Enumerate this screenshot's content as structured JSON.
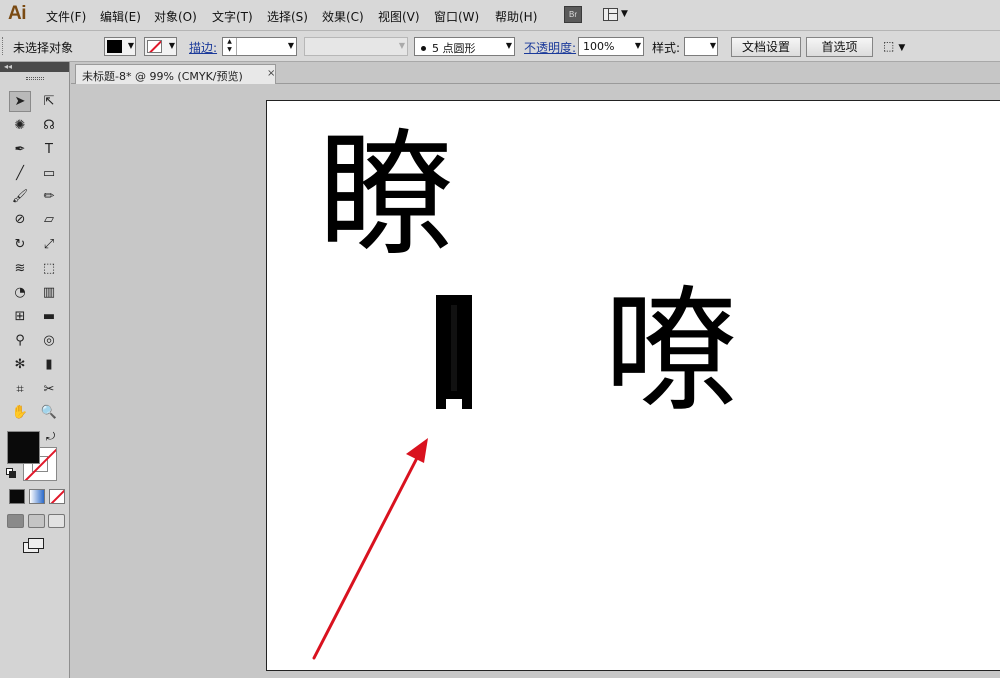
{
  "app": {
    "logo": "Ai"
  },
  "menu": {
    "items": [
      {
        "label": "文件(F)"
      },
      {
        "label": "编辑(E)"
      },
      {
        "label": "对象(O)"
      },
      {
        "label": "文字(T)"
      },
      {
        "label": "选择(S)"
      },
      {
        "label": "效果(C)"
      },
      {
        "label": "视图(V)"
      },
      {
        "label": "窗口(W)"
      },
      {
        "label": "帮助(H)"
      }
    ],
    "bridge_label": "Br"
  },
  "control": {
    "selection_status": "未选择对象",
    "fill_color": "#000000",
    "stroke_color": "none",
    "stroke_label": "描边:",
    "brush_value": "5 点圆形",
    "opacity_label": "不透明度:",
    "opacity_value": "100%",
    "style_label": "样式:",
    "doc_setup_button": "文档设置",
    "prefs_button": "首选项"
  },
  "tools": {
    "collapse_glyph": "◂◂",
    "items": [
      {
        "icon": "selection-tool-icon",
        "glyph": "➤",
        "active": true
      },
      {
        "icon": "direct-selection-tool-icon",
        "glyph": "⇱"
      },
      {
        "icon": "magic-wand-tool-icon",
        "glyph": "✺"
      },
      {
        "icon": "lasso-tool-icon",
        "glyph": "☊"
      },
      {
        "icon": "pen-tool-icon",
        "glyph": "✒"
      },
      {
        "icon": "type-tool-icon",
        "glyph": "T"
      },
      {
        "icon": "line-tool-icon",
        "glyph": "╱"
      },
      {
        "icon": "rectangle-tool-icon",
        "glyph": "▭"
      },
      {
        "icon": "paintbrush-tool-icon",
        "glyph": "🖌"
      },
      {
        "icon": "pencil-tool-icon",
        "glyph": "✏"
      },
      {
        "icon": "blob-brush-tool-icon",
        "glyph": "⊘"
      },
      {
        "icon": "eraser-tool-icon",
        "glyph": "▱"
      },
      {
        "icon": "rotate-tool-icon",
        "glyph": "↻"
      },
      {
        "icon": "scale-tool-icon",
        "glyph": "⤢"
      },
      {
        "icon": "warp-tool-icon",
        "glyph": "≋"
      },
      {
        "icon": "free-transform-tool-icon",
        "glyph": "⬚"
      },
      {
        "icon": "shape-builder-tool-icon",
        "glyph": "◔"
      },
      {
        "icon": "perspective-grid-tool-icon",
        "glyph": "▥"
      },
      {
        "icon": "mesh-tool-icon",
        "glyph": "⊞"
      },
      {
        "icon": "gradient-tool-icon",
        "glyph": "▬"
      },
      {
        "icon": "eyedropper-tool-icon",
        "glyph": "⚲"
      },
      {
        "icon": "blend-tool-icon",
        "glyph": "◎"
      },
      {
        "icon": "symbol-sprayer-tool-icon",
        "glyph": "✻"
      },
      {
        "icon": "column-graph-tool-icon",
        "glyph": "▮"
      },
      {
        "icon": "artboard-tool-icon",
        "glyph": "⌗"
      },
      {
        "icon": "slice-tool-icon",
        "glyph": "✂"
      },
      {
        "icon": "hand-tool-icon",
        "glyph": "✋"
      },
      {
        "icon": "zoom-tool-icon",
        "glyph": "🔍"
      }
    ],
    "fill_color": "#000000",
    "stroke_color": "none"
  },
  "document": {
    "tab_title": "未标题-8* @ 99% (CMYK/预览)",
    "tab_close": "×"
  },
  "canvas": {
    "glyph_top": "瞭",
    "glyph_right": "嘹",
    "arrow_color": "#d9121f"
  }
}
